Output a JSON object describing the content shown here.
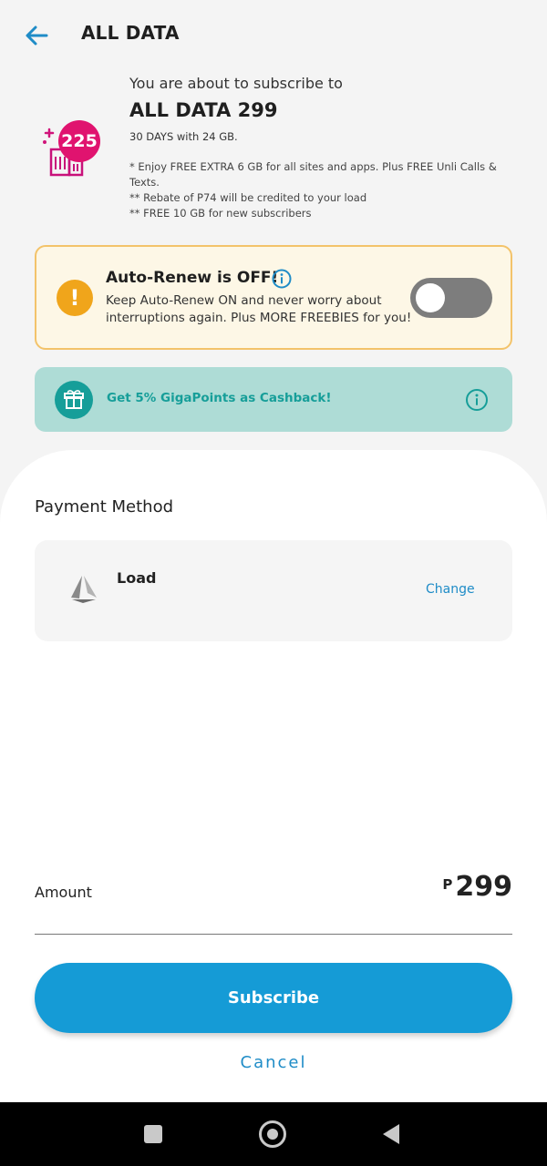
{
  "header": {
    "back_icon": "arrow-left-icon",
    "title": "ALL DATA"
  },
  "offer": {
    "badge_value": "225",
    "about_text": "You are about to subscribe to",
    "plan_name": "ALL DATA 299",
    "validity": "30 DAYS with 24 GB.",
    "notes": [
      "* Enjoy FREE EXTRA 6 GB for all sites and apps. Plus FREE Unli Calls & Texts.",
      "** Rebate of P74 will be credited to your load",
      "** FREE 10 GB for new subscribers"
    ]
  },
  "auto_renew": {
    "title": "Auto-Renew is OFF!",
    "description": "Keep Auto-Renew ON and never worry about interruptions again. Plus MORE FREEBIES for you!",
    "toggle_on": false,
    "warning_glyph": "!"
  },
  "cashback": {
    "text": "Get 5% GigaPoints as Cashback!"
  },
  "payment": {
    "section_title": "Payment Method",
    "method_label": "Load",
    "change_label": "Change"
  },
  "amount": {
    "label": "Amount",
    "currency": "P",
    "value": "299"
  },
  "actions": {
    "subscribe_label": "Subscribe",
    "cancel_label": "Cancel"
  },
  "colors": {
    "accent_blue": "#159bd6",
    "warning_orange": "#f0a51b",
    "teal": "#169e99",
    "badge_magenta": "#e0136f"
  }
}
